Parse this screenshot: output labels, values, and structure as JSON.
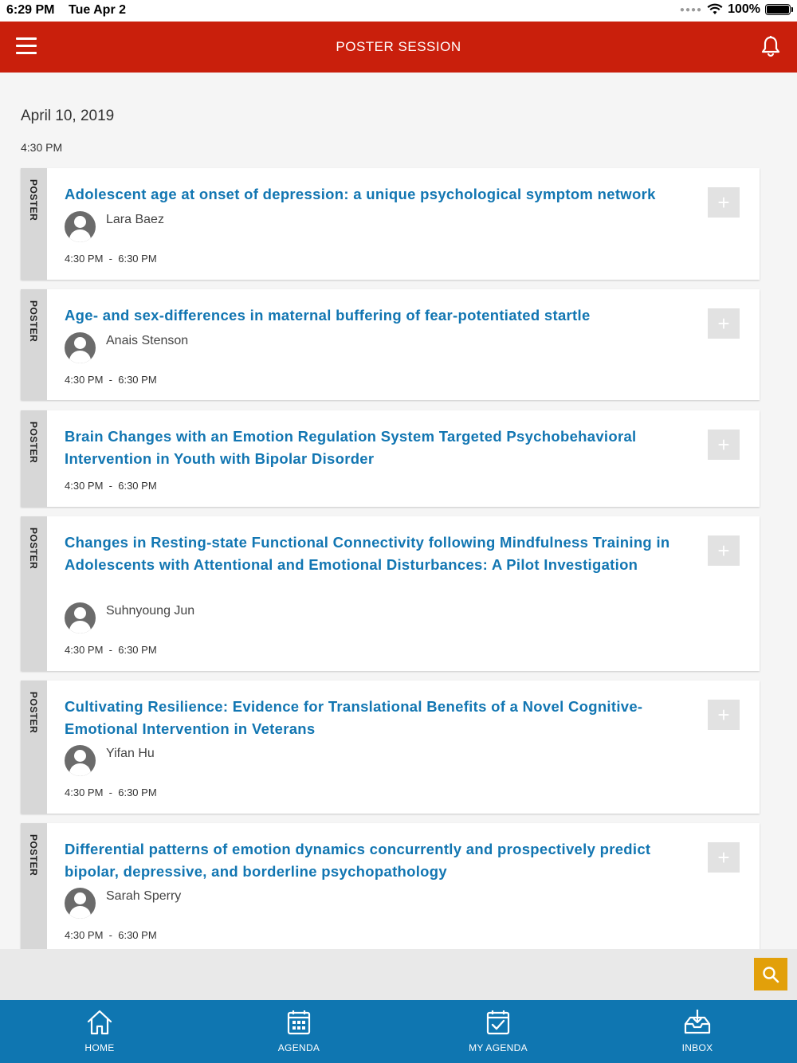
{
  "status_bar": {
    "time": "6:29 PM",
    "date": "Tue Apr 2",
    "battery": "100%"
  },
  "header": {
    "title": "POSTER SESSION"
  },
  "content": {
    "date": "April 10, 2019",
    "time": "4:30 PM"
  },
  "sessions": [
    {
      "tag": "POSTER",
      "title": "Adolescent age at onset of depression: a unique psychological symptom network",
      "author": "Lara Baez",
      "start": "4:30 PM",
      "sep": "-",
      "end": "6:30 PM"
    },
    {
      "tag": "POSTER",
      "title": "Age- and sex-differences in maternal buffering of fear-potentiated startle",
      "author": "Anais Stenson",
      "start": "4:30 PM",
      "sep": "-",
      "end": "6:30 PM"
    },
    {
      "tag": "POSTER",
      "title": "Brain Changes with an Emotion Regulation System Targeted Psychobehavioral Intervention in Youth with Bipolar Disorder",
      "author": "",
      "start": "4:30 PM",
      "sep": "-",
      "end": "6:30 PM"
    },
    {
      "tag": "POSTER",
      "title": "Changes in Resting-state Functional Connectivity following Mindfulness Training in Adolescents with Attentional and Emotional Disturbances: A Pilot Investigation",
      "author": "Suhnyoung Jun",
      "start": "4:30 PM",
      "sep": "-",
      "end": "6:30 PM"
    },
    {
      "tag": "POSTER",
      "title": "Cultivating Resilience: Evidence for Translational Benefits of a Novel Cognitive-Emotional Intervention in Veterans",
      "author": "Yifan Hu",
      "start": "4:30 PM",
      "sep": "-",
      "end": "6:30 PM"
    },
    {
      "tag": "POSTER",
      "title": "Differential patterns of emotion dynamics concurrently and prospectively predict bipolar, depressive, and borderline psychopathology",
      "author": "Sarah Sperry",
      "start": "4:30 PM",
      "sep": "-",
      "end": "6:30 PM"
    }
  ],
  "add_button": "+",
  "tabs": [
    {
      "label": "HOME",
      "icon": "home-icon"
    },
    {
      "label": "AGENDA",
      "icon": "calendar-icon"
    },
    {
      "label": "MY AGENDA",
      "icon": "calendar-check-icon"
    },
    {
      "label": "INBOX",
      "icon": "inbox-icon"
    }
  ],
  "colors": {
    "header": "#c91f0c",
    "title_link": "#1276b2",
    "tabbar": "#0f76b1",
    "search_fab": "#e2a00a"
  }
}
